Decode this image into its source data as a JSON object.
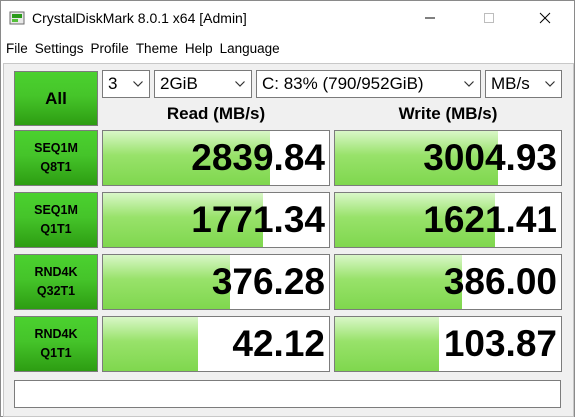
{
  "window": {
    "title": "CrystalDiskMark 8.0.1 x64 [Admin]",
    "controls": [
      "minimize",
      "maximize",
      "close"
    ]
  },
  "menu": [
    "File",
    "Settings",
    "Profile",
    "Theme",
    "Help",
    "Language"
  ],
  "toolbar": {
    "all_label": "All",
    "count": "3",
    "size": "2GiB",
    "drive": "C: 83% (790/952GiB)",
    "unit": "MB/s"
  },
  "headers": {
    "read": "Read (MB/s)",
    "write": "Write (MB/s)"
  },
  "tests": [
    {
      "line1": "SEQ1M",
      "line2": "Q8T1",
      "read": "2839.84",
      "write": "3004.93",
      "read_fill": 0.74,
      "write_fill": 0.72
    },
    {
      "line1": "SEQ1M",
      "line2": "Q1T1",
      "read": "1771.34",
      "write": "1621.41",
      "read_fill": 0.71,
      "write_fill": 0.71
    },
    {
      "line1": "RND4K",
      "line2": "Q32T1",
      "read": "376.28",
      "write": "386.00",
      "read_fill": 0.56,
      "write_fill": 0.56
    },
    {
      "line1": "RND4K",
      "line2": "Q1T1",
      "read": "42.12",
      "write": "103.87",
      "read_fill": 0.42,
      "write_fill": 0.46
    }
  ],
  "comment": "",
  "colors": {
    "button_green": "#46c52a",
    "bar_green": "#98e26a",
    "panel_bg": "#f0f0f0"
  }
}
